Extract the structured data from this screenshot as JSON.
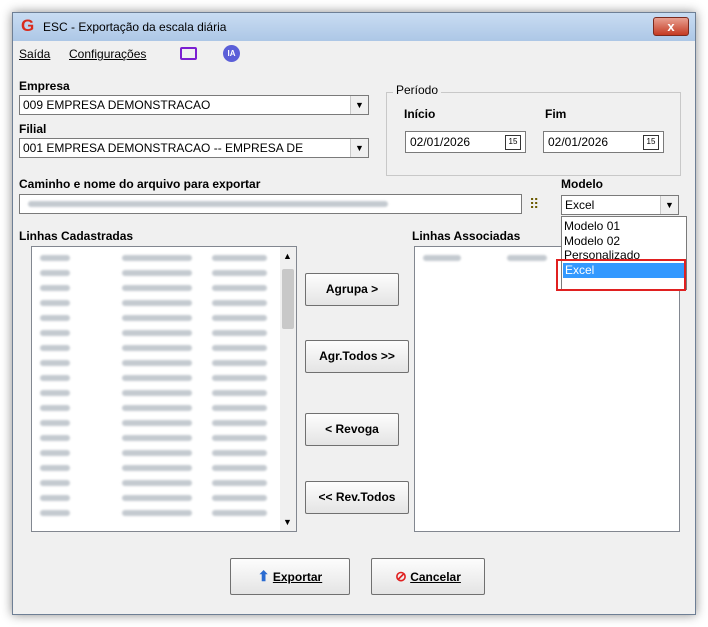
{
  "window": {
    "title": "ESC - Exportação da escala diária",
    "close_glyph": "x"
  },
  "menu": {
    "items": [
      "Saída",
      "Configurações"
    ],
    "ia_badge": "IA"
  },
  "empresa": {
    "label": "Empresa",
    "value": "009 EMPRESA DEMONSTRACAO"
  },
  "filial": {
    "label": "Filial",
    "value": "001 EMPRESA DEMONSTRACAO -- EMPRESA DE"
  },
  "periodo": {
    "legend": "Período",
    "inicio_label": "Início",
    "inicio_value": "02/01/2026",
    "fim_label": "Fim",
    "fim_value": "02/01/2026",
    "cal_glyph": "15"
  },
  "caminho": {
    "label": "Caminho e nome do arquivo para exportar"
  },
  "modelo": {
    "label": "Modelo",
    "selected": "Excel",
    "options": [
      "Modelo 01",
      "Modelo 02",
      "Personalizado",
      "Excel"
    ],
    "highlighted_index": 3
  },
  "linhas_cadastradas": {
    "label": "Linhas Cadastradas"
  },
  "linhas_associadas": {
    "label": "Linhas Associadas"
  },
  "buttons": {
    "agrupa": "Agrupa >",
    "agr_todos": "Agr.Todos >>",
    "revoga": "< Revoga",
    "rev_todos": "<< Rev.Todos",
    "exportar": "Exportar",
    "cancelar": "Cancelar"
  },
  "colors": {
    "highlight": "#3399ff",
    "annotation_red": "#e02020",
    "title_gradient": "#adc7e6"
  }
}
